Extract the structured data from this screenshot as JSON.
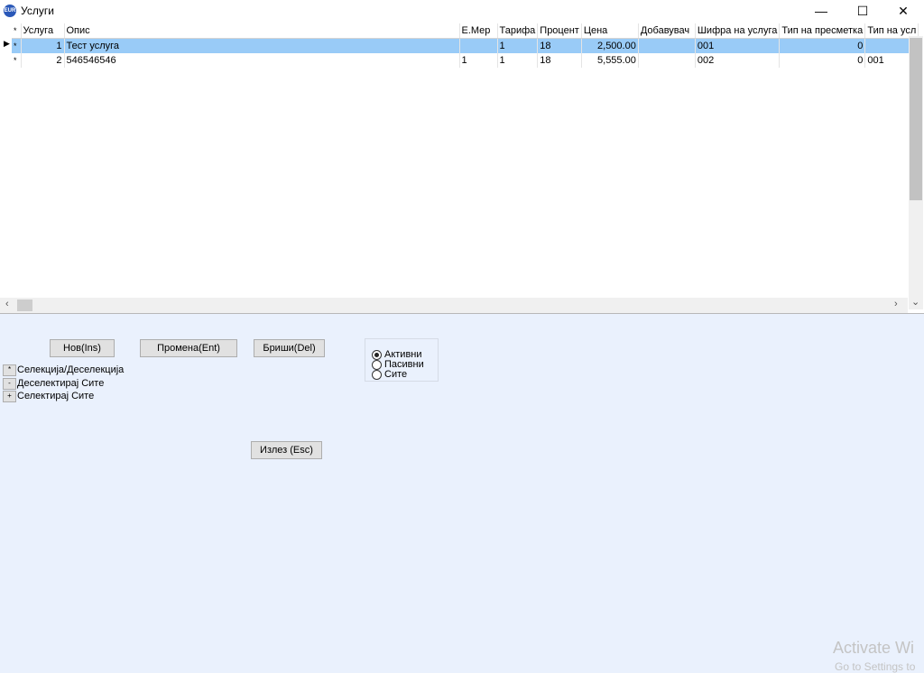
{
  "window": {
    "title": "Услуги",
    "icon_name": "app-logo-icon",
    "minimize_glyph": "—",
    "maximize_glyph": "☐",
    "close_glyph": "✕"
  },
  "grid": {
    "columns": [
      "*",
      "Услуга",
      "Опис",
      "Е.Мер",
      "Тарифа",
      "Процент",
      "Цена",
      "Добавувач",
      "Шифра на услуга",
      "Тип на пресметка",
      "Тип на усл"
    ],
    "rows": [
      {
        "marker": "*",
        "usluga": "1",
        "opis": "Тест услуга",
        "emer": "",
        "tarifa": "1",
        "procent": "18",
        "cena": "2,500.00",
        "dobavuvac": "",
        "sifra": "001",
        "tip_presmetka": "0",
        "tip_usl": ""
      },
      {
        "marker": "*",
        "usluga": "2",
        "opis": "546546546",
        "emer": "1",
        "tarifa": "1",
        "procent": "18",
        "cena": "5,555.00",
        "dobavuvac": "",
        "sifra": "002",
        "tip_presmetka": "0",
        "tip_usl": "001"
      }
    ],
    "current_row_indicator": "▶"
  },
  "buttons": {
    "new": "Нов(Ins)",
    "edit": "Промена(Ent)",
    "delete": "Бриши(Del)",
    "exit": "Излез (Esc)"
  },
  "selection": {
    "toggle_symbol": "*",
    "toggle_label": "Селекција/Деселекција",
    "deselect_symbol": "-",
    "deselect_label": "Деселектирај Сите",
    "select_symbol": "+",
    "select_label": "Селектирај Сите"
  },
  "filter": {
    "options": [
      "Активни",
      "Пасивни",
      "Сите"
    ],
    "selected": "Активни"
  },
  "watermark": {
    "line1": "Activate Wi",
    "line2": "Go to Settings to"
  }
}
